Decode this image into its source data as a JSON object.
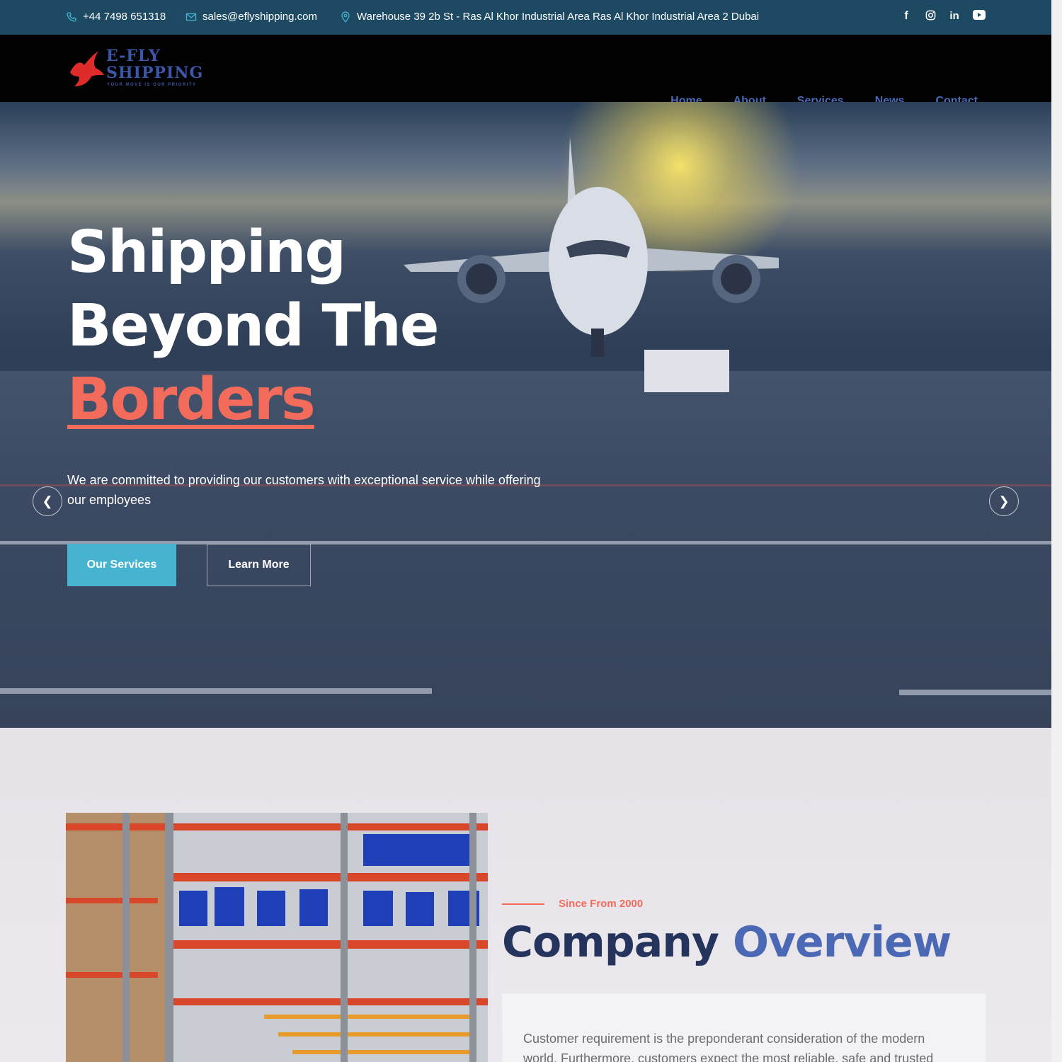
{
  "topbar": {
    "phone": "+44 7498 651318",
    "email": "sales@eflyshipping.com",
    "address": "Warehouse 39 2b St - Ras Al Khor Industrial Area Ras Al Khor Industrial Area 2 Dubai",
    "socials": [
      "facebook-icon",
      "instagram-icon",
      "linkedin-icon",
      "youtube-icon"
    ]
  },
  "brand": {
    "line1": "E-FLY",
    "line2": "SHIPPING",
    "tagline": "YOUR MOVE IS OUR PRIORITY"
  },
  "nav": {
    "items": [
      "Home",
      "About",
      "Services",
      "News",
      "Contact"
    ]
  },
  "hero": {
    "line1": "Shipping",
    "line2": "Beyond The",
    "line3": "Borders",
    "description": "We are committed to providing our customers with exceptional service while offering our employees",
    "primary_button": "Our Services",
    "secondary_button": "Learn More"
  },
  "overview": {
    "kicker": "Since From 2000",
    "title_a": "Company",
    "title_b": "Overview",
    "body": "Customer requirement is the preponderant consideration of the modern world. Furthermore, customers expect the most reliable, safe and trusted"
  },
  "colors": {
    "topbar": "#1d4963",
    "accent_red": "#f26b5b",
    "accent_blue": "#4a68b4",
    "button": "#46b3d0"
  }
}
